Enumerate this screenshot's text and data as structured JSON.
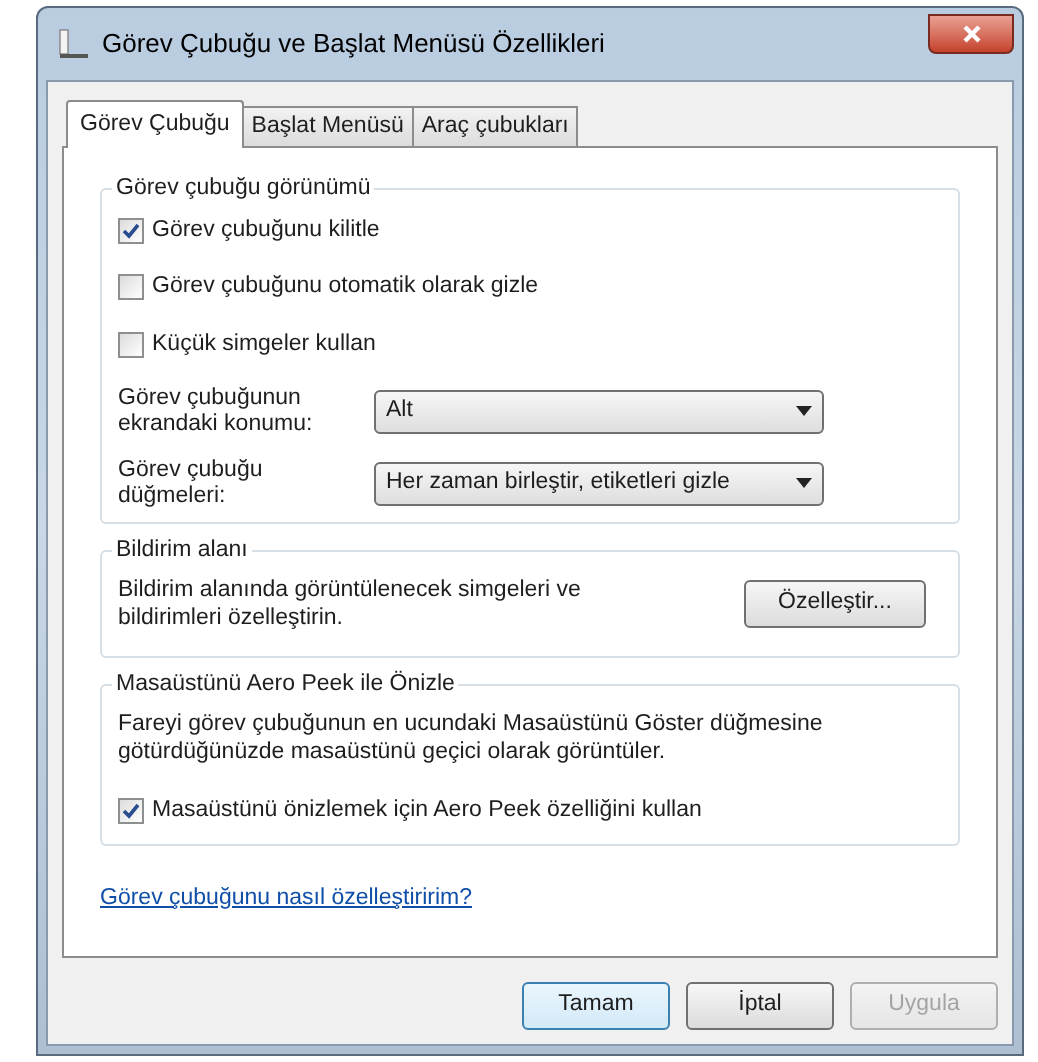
{
  "window": {
    "title": "Görev Çubuğu ve Başlat Menüsü Özellikleri"
  },
  "tabs": [
    {
      "label": "Görev Çubuğu",
      "selected": true
    },
    {
      "label": "Başlat Menüsü",
      "selected": false
    },
    {
      "label": "Araç çubukları",
      "selected": false
    }
  ],
  "appearance": {
    "title": "Görev çubuğu görünümü",
    "checkboxes": [
      {
        "label": "Görev çubuğunu kilitle",
        "checked": true
      },
      {
        "label": "Görev çubuğunu otomatik olarak gizle",
        "checked": false
      },
      {
        "label": "Küçük simgeler kullan",
        "checked": false
      }
    ],
    "dropdowns": [
      {
        "label": "Görev çubuğunun ekrandaki konumu:",
        "value": "Alt"
      },
      {
        "label": "Görev çubuğu düğmeleri:",
        "value": "Her zaman birleştir, etiketleri gizle"
      }
    ]
  },
  "notification": {
    "title": "Bildirim alanı",
    "text": "Bildirim alanında görüntülenecek simgeleri ve bildirimleri özelleştirin.",
    "button": "Özelleştir..."
  },
  "peek": {
    "title": "Masaüstünü Aero Peek ile Önizle",
    "text": "Fareyi görev çubuğunun en ucundaki Masaüstünü Göster düğmesine götürdüğünüzde masaüstünü geçici olarak görüntüler.",
    "checkbox": {
      "label": "Masaüstünü önizlemek için Aero Peek özelliğini kullan",
      "checked": true
    }
  },
  "help_link": "Görev çubuğunu nasıl özelleştiririm?",
  "buttons": [
    {
      "label": "Tamam",
      "default": true,
      "disabled": false
    },
    {
      "label": "İptal",
      "default": false,
      "disabled": false
    },
    {
      "label": "Uygula",
      "default": false,
      "disabled": true
    }
  ]
}
